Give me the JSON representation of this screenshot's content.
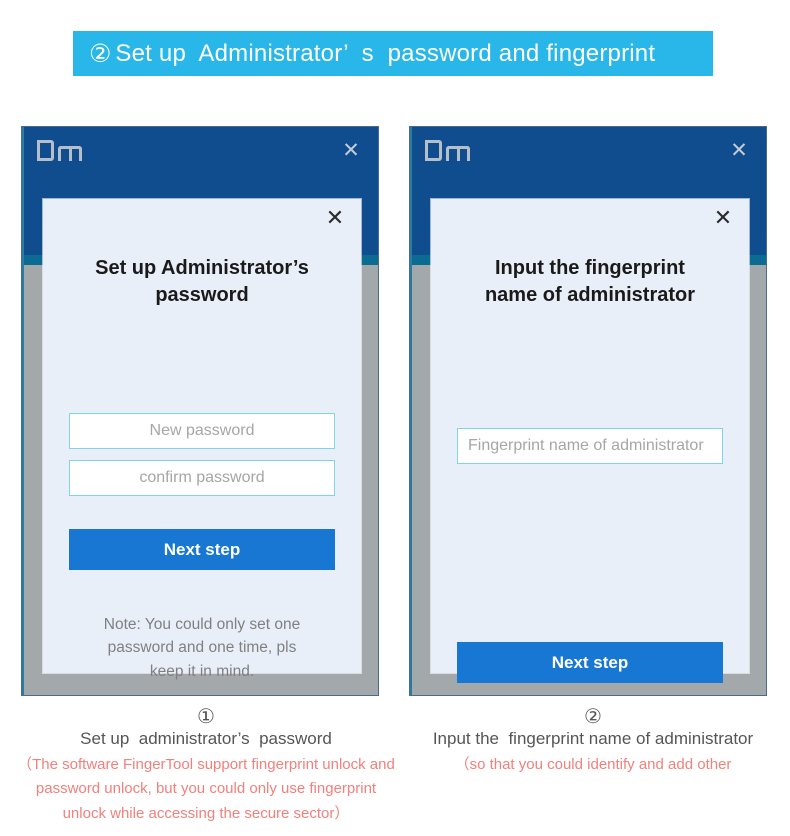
{
  "banner": {
    "number": "②",
    "text": "Set up  Administrator’  s  password and fingerprint",
    "background": "#29b6e8",
    "text_color": "#ffffff"
  },
  "colors": {
    "window_header": "#0f4d8f",
    "window_body": "#a3a8ab",
    "window_accent": "#0c6b93",
    "dialog_bg": "#e9eff8",
    "input_border": "#7fd4e8",
    "button_blue": "#1877d2",
    "note_gray": "#808080",
    "caption_red": "#f2807c"
  },
  "windows": [
    {
      "id": "set-password",
      "logo": "DM",
      "close_label": "✕",
      "dialog": {
        "close_label": "✕",
        "title": "Set up  Administrator’s\npassword",
        "fields": [
          {
            "name": "new-password",
            "placeholder": "New password",
            "value": "",
            "align": "center"
          },
          {
            "name": "confirm-password",
            "placeholder": "confirm password",
            "value": "",
            "align": "center"
          }
        ],
        "button_label": "Next step",
        "note": "Note: You could only set one\npassword and one time, pls\nkeep it in mind."
      }
    },
    {
      "id": "fingerprint-name",
      "logo": "DM",
      "close_label": "✕",
      "dialog": {
        "close_label": "✕",
        "title": "Input the fingerprint\nname of administrator",
        "fields": [
          {
            "name": "fingerprint-name",
            "placeholder": "Fingerprint name of administrator",
            "value": "",
            "align": "left"
          }
        ],
        "button_label": "Next step",
        "note": ""
      }
    }
  ],
  "captions": [
    {
      "number": "①",
      "main": "Set up  administrator’s  password",
      "sub": "（The software FingerTool support fingerprint unlock and\npassword unlock, but you could only use fingerprint\nunlock while accessing the secure sector）"
    },
    {
      "number": "②",
      "main": "Input the  fingerprint name of administrator",
      "sub": "（so that you could identify and add other"
    }
  ]
}
